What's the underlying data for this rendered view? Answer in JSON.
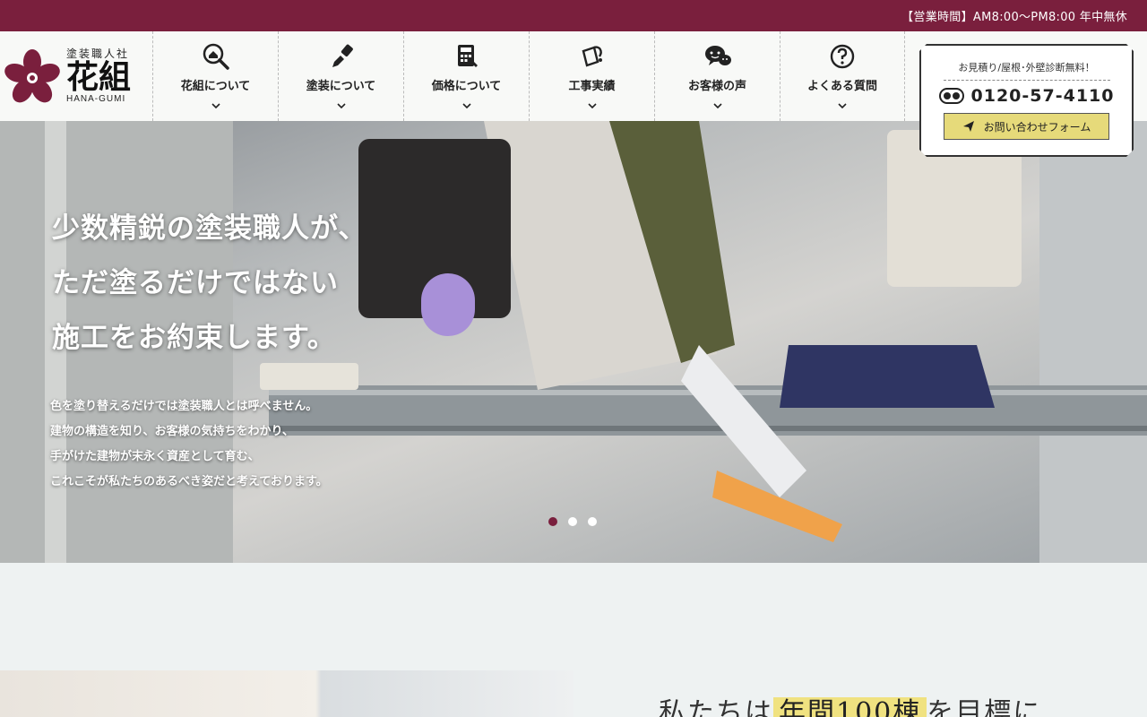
{
  "topbar": {
    "hours": "【営業時間】AM8:00〜PM8:00 年中無休"
  },
  "brand": {
    "subtitle": "塗装職人社",
    "name": "花組",
    "roman": "HANA-GUMI"
  },
  "nav": {
    "items": [
      {
        "label": "花組について",
        "icon": "search-house-icon"
      },
      {
        "label": "塗装について",
        "icon": "paint-brush-icon"
      },
      {
        "label": "価格について",
        "icon": "calculator-icon"
      },
      {
        "label": "工事実績",
        "icon": "paint-bucket-icon"
      },
      {
        "label": "お客様の声",
        "icon": "speech-bubbles-icon"
      },
      {
        "label": "よくある質問",
        "icon": "question-icon"
      }
    ]
  },
  "contact": {
    "note": "お見積り/屋根･外壁診断無料！",
    "phone": "0120-57-4110",
    "button": "お問い合わせフォーム"
  },
  "hero": {
    "headline": [
      "少数精鋭の塗装職人が、",
      "ただ塗るだけではない",
      "施工をお約束します。"
    ],
    "body": [
      "色を塗り替えるだけでは塗装職人とは呼べません。",
      "建物の構造を知り、お客様の気持ちをわかり、",
      "手がけた建物が末永く資産として育む、",
      "これこそが私たちのあるべき姿だと考えております。"
    ],
    "slides": 3,
    "active_slide": 1
  },
  "section": {
    "heading_pre": "私たちは",
    "heading_highlight": "年間100棟",
    "heading_post": "を目標に"
  },
  "colors": {
    "brand": "#7a1f3d",
    "accent": "#e6da7a"
  }
}
